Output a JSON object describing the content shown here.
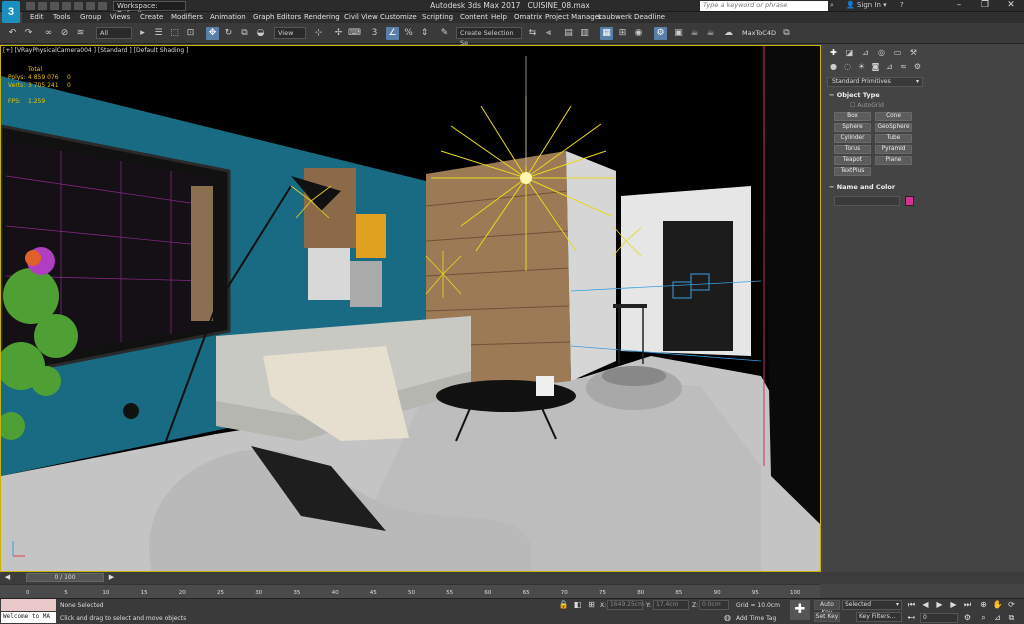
{
  "app": {
    "logo_text": "3",
    "title": "Autodesk 3ds Max 2017",
    "filename": "CUISINE_08.max",
    "workspace": "Workspace: Default",
    "search_placeholder": "Type a keyword or phrase",
    "sign_in": "Sign In",
    "help": "?"
  },
  "menu": [
    "Edit",
    "Tools",
    "Group",
    "Views",
    "Create",
    "Modifiers",
    "Animation",
    "Graph Editors",
    "Rendering",
    "Civil View",
    "Customize",
    "Scripting",
    "Content",
    "Help",
    "Omatrix",
    "Project Manager",
    "Laubwerk",
    "Deadline"
  ],
  "toolbar": {
    "selection_filter": "All",
    "ref_coord": "View",
    "selection_set": "Create Selection Se",
    "maxtoc4d": "MaxToC4D"
  },
  "viewport": {
    "label": "[+] [VRayPhysicalCamera004 ] [Standard ] [Default Shading ]",
    "stats": {
      "total_label": "Total",
      "polys_label": "Polys:",
      "polys_value": "4 859 076",
      "polys_sel": "0",
      "verts_label": "Verts:",
      "verts_value": "3 705 241",
      "verts_sel": "0",
      "fps_label": "FPS:",
      "fps_value": "1.259"
    }
  },
  "command_panel": {
    "category": "Standard Primitives",
    "object_type_header": "Object Type",
    "autogrid": "AutoGrid",
    "primitives": [
      "Box",
      "Cone",
      "Sphere",
      "GeoSphere",
      "Cylinder",
      "Tube",
      "Torus",
      "Pyramid",
      "Teapot",
      "Plane",
      "TextPlus"
    ],
    "name_color_header": "Name and Color",
    "object_color": "#d2338f"
  },
  "timeline": {
    "frame": "0 / 100",
    "ticks": [
      "0",
      "5",
      "10",
      "15",
      "20",
      "25",
      "30",
      "35",
      "40",
      "45",
      "50",
      "55",
      "60",
      "65",
      "70",
      "75",
      "80",
      "85",
      "90",
      "95",
      "100"
    ]
  },
  "status": {
    "selection": "None Selected",
    "prompt": "Click and drag to select and move objects",
    "x_label": "X:",
    "x_value": "1649.25cm",
    "y_label": "Y:",
    "y_value": "17.4cm",
    "z_label": "Z:",
    "z_value": "0.0cm",
    "grid": "Grid = 10.0cm",
    "add_time_tag": "Add Time Tag",
    "auto_key": "Auto Key",
    "set_key": "Set Key",
    "selected": "Selected",
    "key_filters": "Key Filters...",
    "frame_field": "0",
    "welcome": "Welcome to MA"
  }
}
